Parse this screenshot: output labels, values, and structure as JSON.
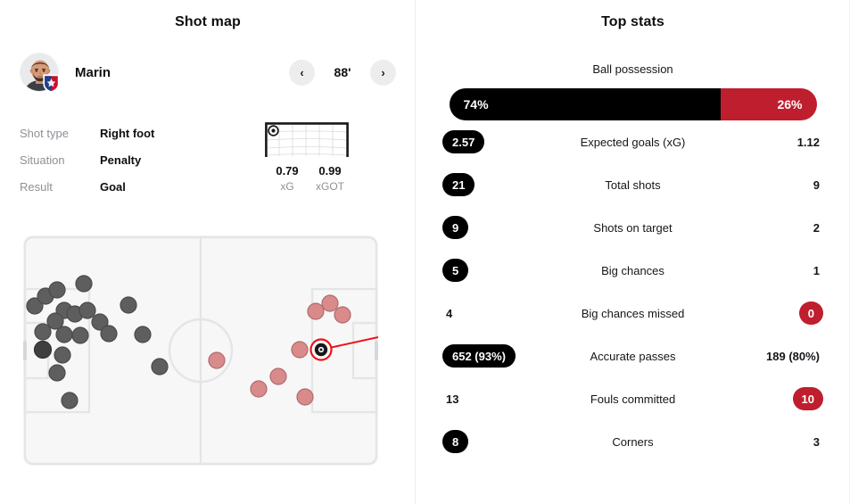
{
  "shot_map": {
    "title": "Shot map",
    "player": {
      "name": "Marin",
      "avatar_icon": "player-photo",
      "crest_icon": "team-crest-icon"
    },
    "nav": {
      "prev_icon": "chevron-left-icon",
      "next_icon": "chevron-right-icon",
      "minute": "88'"
    },
    "details": [
      {
        "label": "Shot type",
        "value": "Right foot"
      },
      {
        "label": "Situation",
        "value": "Penalty"
      },
      {
        "label": "Result",
        "value": "Goal"
      }
    ],
    "goal_frame": {
      "ball_icon": "ball-icon",
      "ball_x_pct": 7,
      "ball_y_pct": 16,
      "metrics": [
        {
          "value": "0.79",
          "key": "xG"
        },
        {
          "value": "0.99",
          "key": "xGOT"
        }
      ]
    },
    "pitch": {
      "home_shot_color": "#5e5e5e",
      "away_shot_color": "#d98a8a",
      "highlight_color": "#f0121a",
      "line_color": "#e4e5e7",
      "field_color": "#f7f7f8"
    }
  },
  "top_stats": {
    "title": "Top stats",
    "possession": {
      "label": "Ball possession",
      "home": "74%",
      "away": "26%",
      "home_pct": 74,
      "away_pct": 26,
      "home_color": "#000000",
      "away_color": "#be1e2d"
    },
    "rows": [
      {
        "name": "Expected goals (xG)",
        "home": "2.57",
        "away": "1.12",
        "home_style": "pill",
        "away_style": "plain"
      },
      {
        "name": "Total shots",
        "home": "21",
        "away": "9",
        "home_style": "pill",
        "away_style": "plain"
      },
      {
        "name": "Shots on target",
        "home": "9",
        "away": "2",
        "home_style": "pill",
        "away_style": "plain"
      },
      {
        "name": "Big chances",
        "home": "5",
        "away": "1",
        "home_style": "pill",
        "away_style": "plain"
      },
      {
        "name": "Big chances missed",
        "home": "4",
        "away": "0",
        "home_style": "plain",
        "away_style": "pill-red"
      },
      {
        "name": "Accurate passes",
        "home": "652 (93%)",
        "away": "189 (80%)",
        "home_style": "pill",
        "away_style": "plain"
      },
      {
        "name": "Fouls committed",
        "home": "13",
        "away": "10",
        "home_style": "plain",
        "away_style": "pill-red"
      },
      {
        "name": "Corners",
        "home": "8",
        "away": "3",
        "home_style": "pill",
        "away_style": "plain"
      }
    ]
  },
  "chart_data": {
    "type": "scatter",
    "title": "Shot map",
    "xlabel": "",
    "ylabel": "",
    "xlim": [
      0,
      100
    ],
    "ylim": [
      0,
      100
    ],
    "grid": false,
    "legend": "none",
    "series": [
      {
        "name": "Home shots",
        "color": "#5e5e5e",
        "points": [
          [
            3.3,
            30.5
          ],
          [
            6.2,
            26.3
          ],
          [
            9.5,
            23.5
          ],
          [
            17.0,
            21.0
          ],
          [
            11.5,
            32.5
          ],
          [
            14.6,
            34.2
          ],
          [
            18.0,
            32.5
          ],
          [
            9.0,
            37.0
          ],
          [
            5.5,
            42.0
          ],
          [
            11.5,
            43.0
          ],
          [
            16.0,
            43.5
          ],
          [
            21.5,
            37.5
          ],
          [
            24.0,
            42.5
          ],
          [
            29.5,
            30.0
          ],
          [
            33.5,
            43.0
          ],
          [
            11.0,
            52.0
          ],
          [
            9.5,
            59.5
          ],
          [
            13.0,
            71.5
          ],
          [
            38.5,
            57.0
          ],
          [
            13.0,
            49.5
          ]
        ]
      },
      {
        "name": "Away shots",
        "color": "#d98a8a",
        "points": [
          [
            82.5,
            33.0
          ],
          [
            86.5,
            29.5
          ],
          [
            90.0,
            34.5
          ],
          [
            78.0,
            49.5
          ],
          [
            72.0,
            61.0
          ],
          [
            66.5,
            66.5
          ],
          [
            79.5,
            70.0
          ],
          [
            54.5,
            54.0
          ]
        ]
      },
      {
        "name": "Selected shot",
        "color": "#f0121a",
        "points": [
          [
            84.0,
            49.5
          ]
        ],
        "goal_line": [
          [
            84.0,
            49.5
          ],
          [
            100.0,
            44.0
          ]
        ]
      }
    ]
  }
}
